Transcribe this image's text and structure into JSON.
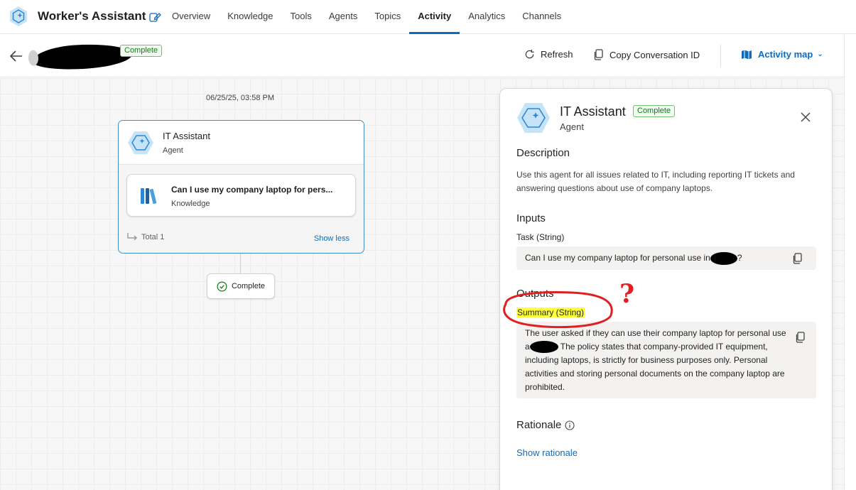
{
  "app": {
    "title": "Worker's Assistant",
    "nav": [
      "Overview",
      "Knowledge",
      "Tools",
      "Agents",
      "Topics",
      "Activity",
      "Analytics",
      "Channels"
    ],
    "active_nav": "Activity"
  },
  "subheader": {
    "status": "Complete",
    "refresh_label": "Refresh",
    "copy_label": "Copy Conversation ID",
    "activity_map_label": "Activity map"
  },
  "canvas": {
    "timestamp": "06/25/25, 03:58 PM",
    "agent_card": {
      "name": "IT Assistant",
      "type": "Agent",
      "knowledge_item": {
        "title": "Can I use my company laptop for pers...",
        "type": "Knowledge"
      },
      "total_label": "Total 1",
      "toggle_label": "Show less"
    },
    "complete_node_label": "Complete"
  },
  "panel": {
    "title": "IT Assistant",
    "status": "Complete",
    "subtitle": "Agent",
    "description_heading": "Description",
    "description": "Use this agent for all issues related to IT, including reporting IT tickets and answering questions about use of company laptops.",
    "inputs_heading": "Inputs",
    "input_label": "Task (String)",
    "input_value_before": "Can I use my company laptop for personal use in",
    "input_value_after": "?",
    "outputs_heading": "Outputs",
    "output_label": "Summary (String)",
    "output_value_part1": "The user asked if they can use their company laptop for personal use a",
    "output_value_part2": " The policy states that company-provided IT equipment, including laptops, is strictly for business purposes only. Personal activities and storing personal documents on the company laptop are prohibited.",
    "rationale_heading": "Rationale",
    "rationale_link": "Show rationale"
  },
  "annotation": {
    "mark": "?",
    "color": "#e02020"
  },
  "colors": {
    "accent": "#0f6cbd",
    "success": "#107c10",
    "highlight": "#ffff3d"
  }
}
